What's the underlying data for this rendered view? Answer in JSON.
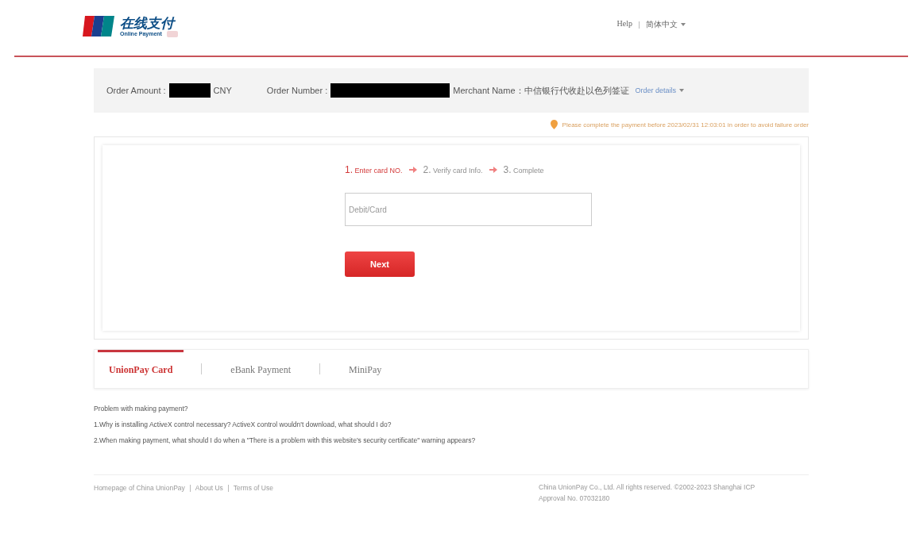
{
  "header": {
    "logo_title": "在线支付",
    "logo_subtitle": "Online Payment",
    "links": [
      "Help"
    ],
    "language": "简体中文"
  },
  "order": {
    "amount_label": "Order Amount :",
    "currency": "CNY",
    "number_label": "Order Number :",
    "merchant_label": "Merchant Name：中信银行代收赴以色列签证",
    "details_link": "Order details"
  },
  "notice": "Please complete the payment before 2023/02/31 12:03:01 in order to avoid failure order",
  "steps": [
    {
      "number": "1.",
      "label": "Enter card NO.",
      "selected": true
    },
    {
      "number": "2.",
      "label": "Verify card Info.",
      "selected": false
    },
    {
      "number": "3.",
      "label": "Complete",
      "selected": false
    }
  ],
  "card_field": {
    "placeholder": "Debit/Card"
  },
  "next_button": "Next",
  "tabs": [
    {
      "label": "UnionPay Card",
      "selected": true
    },
    {
      "label": "eBank Payment",
      "selected": false
    },
    {
      "label": "MiniPay",
      "selected": false
    }
  ],
  "help": {
    "title": "Problem with making payment?",
    "questions": [
      "1.Why is installing ActiveX control necessary? ActiveX control wouldn't download, what should I do?",
      "2.When making payment, what should I do when a \"There is a problem with this website's security certificate\" warning appears?"
    ]
  },
  "footer": {
    "links": [
      "Homepage of China UnionPay",
      "About Us",
      "Terms of Use"
    ],
    "copyright": "China UnionPay Co., Ltd. All rights reserved. ©2002-2023 Shanghai ICP",
    "approval": "Approval No. 07032180"
  }
}
